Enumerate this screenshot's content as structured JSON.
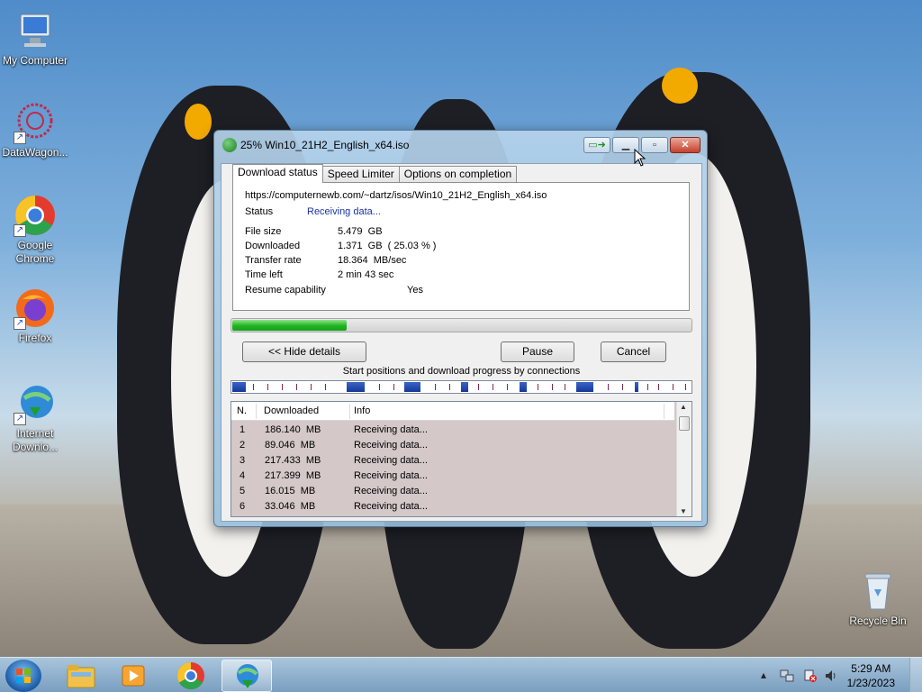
{
  "desktop": {
    "icons": [
      {
        "label": "My Computer",
        "icon": "computer-icon"
      },
      {
        "label": "DataWagon...",
        "icon": "datawagon-icon"
      },
      {
        "label": "Google Chrome",
        "icon": "chrome-icon"
      },
      {
        "label": "Firefox",
        "icon": "firefox-icon"
      },
      {
        "label": "Internet Downlo...",
        "icon": "idm-icon"
      }
    ],
    "recycle_bin": {
      "label": "Recycle Bin",
      "icon": "recycle-bin-icon"
    }
  },
  "window": {
    "title": "25% Win10_21H2_English_x64.iso",
    "tabs": [
      "Download status",
      "Speed Limiter",
      "Options on completion"
    ],
    "active_tab": "Download status",
    "url": "https://computernewb.com/~dartz/isos/Win10_21H2_English_x64.iso",
    "status_label": "Status",
    "status_value": "Receiving data...",
    "fields": [
      {
        "label": "File size",
        "value": "5.479  GB"
      },
      {
        "label": "Downloaded",
        "value": "1.371  GB  ( 25.03 % )"
      },
      {
        "label": "Transfer rate",
        "value": "18.364  MB/sec"
      },
      {
        "label": "Time left",
        "value": "2 min 43 sec"
      }
    ],
    "resume_label": "Resume capability",
    "resume_value": "Yes",
    "progress": 0.2503,
    "buttons": {
      "hide_details": "<< Hide details",
      "pause": "Pause",
      "cancel": "Cancel"
    },
    "connections_caption": "Start positions and download progress by connections",
    "table": {
      "headers": [
        "N.",
        "Downloaded",
        "Info"
      ],
      "rows": [
        {
          "n": "1",
          "downloaded": "186.140  MB",
          "info": "Receiving data..."
        },
        {
          "n": "2",
          "downloaded": "89.046  MB",
          "info": "Receiving data..."
        },
        {
          "n": "3",
          "downloaded": "217.433  MB",
          "info": "Receiving data..."
        },
        {
          "n": "4",
          "downloaded": "217.399  MB",
          "info": "Receiving data..."
        },
        {
          "n": "5",
          "downloaded": "16.015  MB",
          "info": "Receiving data..."
        },
        {
          "n": "6",
          "downloaded": "33.046  MB",
          "info": "Receiving data..."
        }
      ]
    }
  },
  "taskbar": {
    "time": "5:29 AM",
    "date": "1/23/2023"
  },
  "colors": {
    "progress": "#1fb41f",
    "connection_segment": "#16379a",
    "list_bg": "#d4c8c8"
  }
}
